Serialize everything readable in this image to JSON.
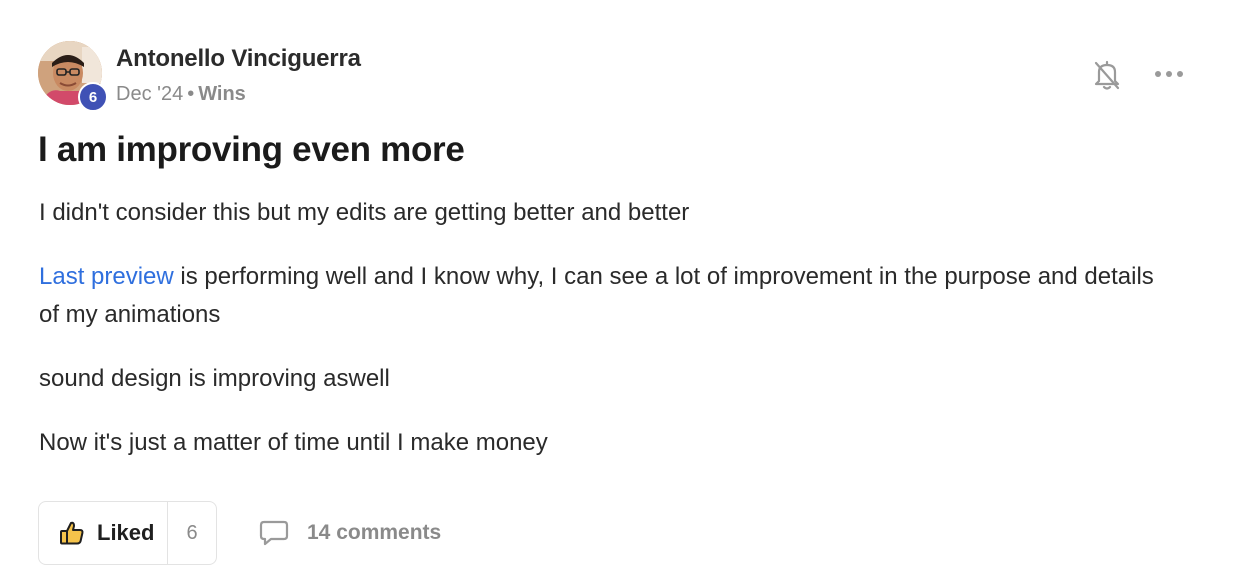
{
  "post": {
    "author": {
      "name": "Antonello Vinciguerra",
      "level": "6",
      "avatar_icon": "avatar-photo"
    },
    "meta": {
      "date": "Dec '24",
      "separator": "•",
      "category": "Wins"
    },
    "header_actions": {
      "notification_icon": "bell-off-icon",
      "more_icon": "more-horizontal-icon"
    },
    "title": "I am improving even more",
    "paragraphs": {
      "p1": "I didn't consider this but my edits are getting better and better",
      "p2_link": "Last preview",
      "p2_rest": " is performing well and I know why, I can see a lot of improvement in the purpose and details of my animations",
      "p3": "sound design is improving aswell",
      "p4": "Now it's just a matter of time until I make money"
    },
    "actions": {
      "like_label": "Liked",
      "like_count": "6",
      "like_icon": "thumbs-up-icon",
      "comments_label": "14 comments",
      "comments_icon": "comment-icon"
    },
    "colors": {
      "accent_link": "#2f6fde",
      "level_badge": "#3f51b5",
      "like_icon_fill": "#f5c34b",
      "muted_text": "#8a8a8a"
    }
  }
}
